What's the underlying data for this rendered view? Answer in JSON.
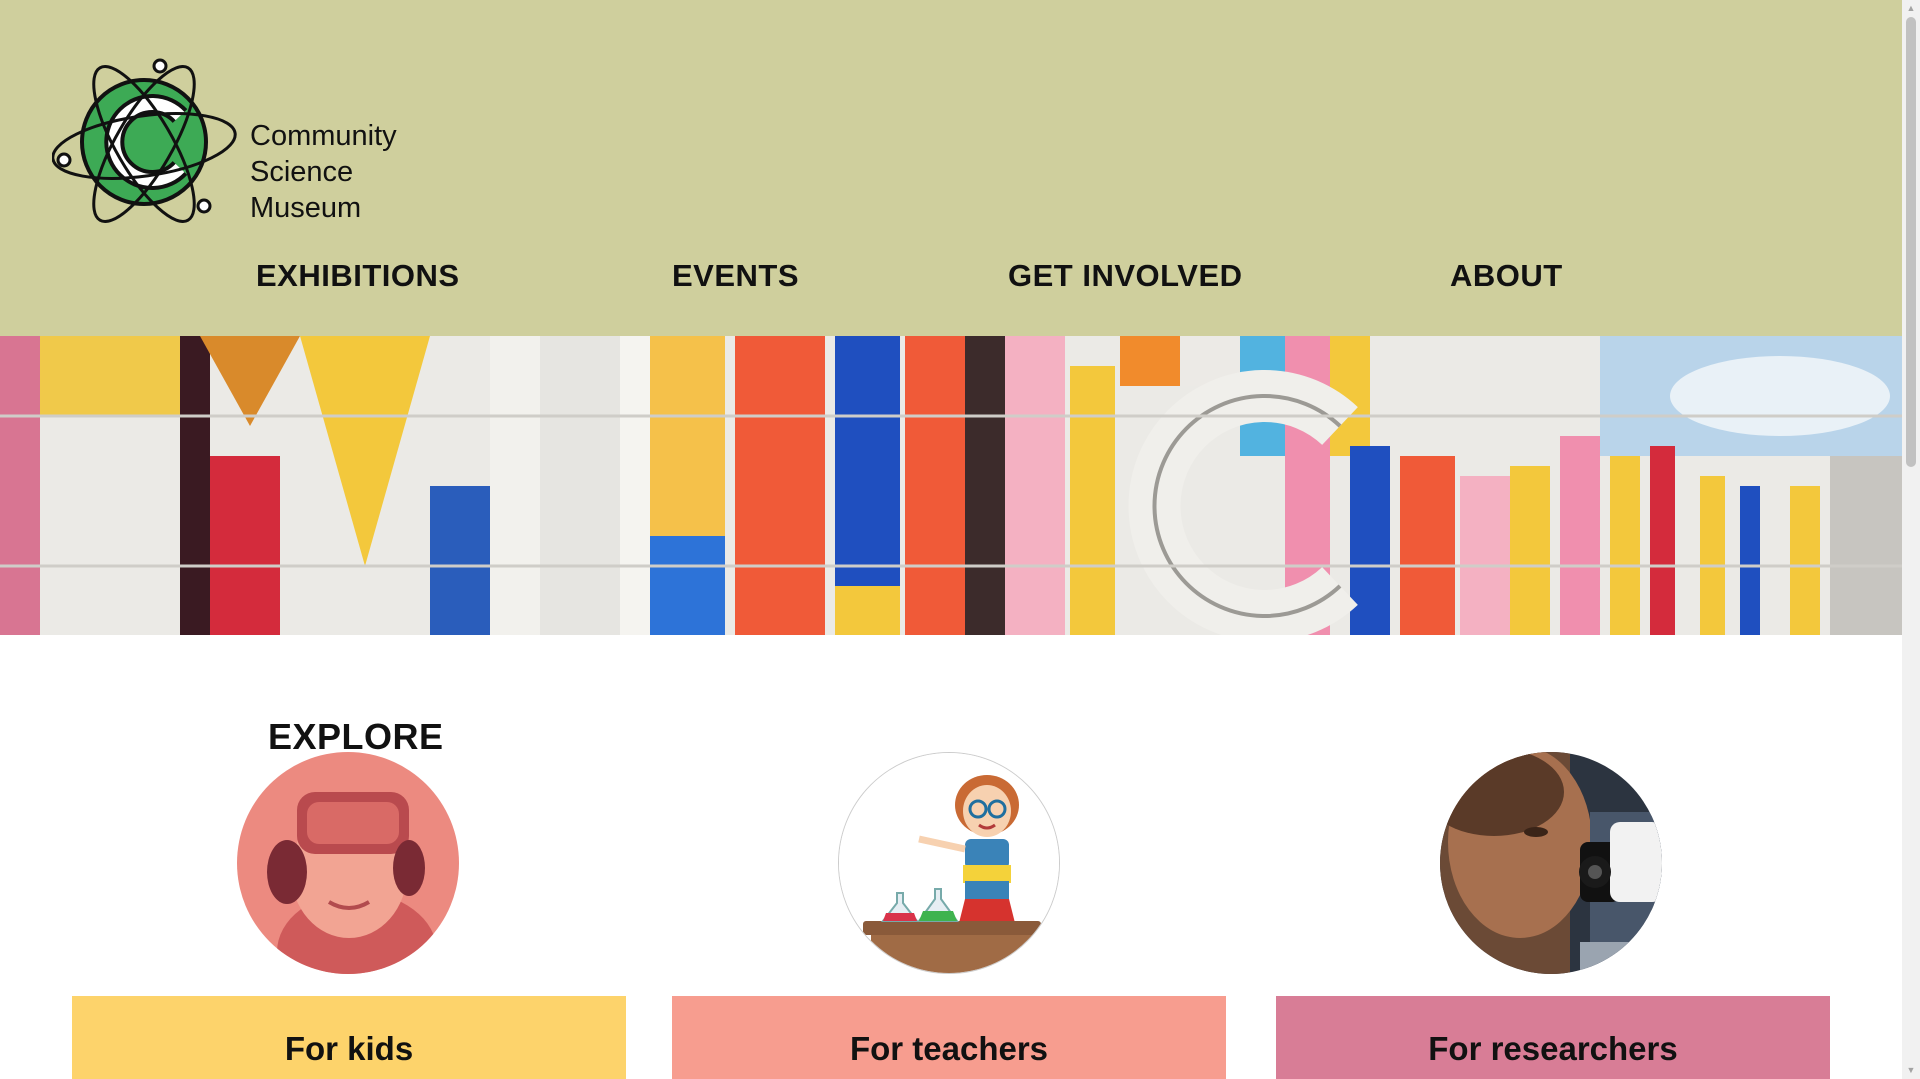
{
  "site": {
    "logo_lines": [
      "Community",
      "Science",
      "Museum"
    ],
    "logo_icon": "atom-c-logo-icon"
  },
  "nav": {
    "items": [
      {
        "label": "EXHIBITIONS"
      },
      {
        "label": "EVENTS"
      },
      {
        "label": "GET INVOLVED"
      },
      {
        "label": "ABOUT"
      }
    ]
  },
  "hero": {
    "image": "colorful-building-facade-image"
  },
  "explore": {
    "title": "EXPLORE",
    "cards": [
      {
        "label": "For kids",
        "image": "child-vr-headset-photo",
        "color": "#fdd36b"
      },
      {
        "label": "For teachers",
        "image": "teacher-cartoon-illustration",
        "color": "#f79d8f"
      },
      {
        "label": "For researchers",
        "image": "researcher-microscope-photo",
        "color": "#d87d96"
      }
    ]
  },
  "colors": {
    "header_bg": "#cfcf9d",
    "logo_green": "#3daa55"
  }
}
